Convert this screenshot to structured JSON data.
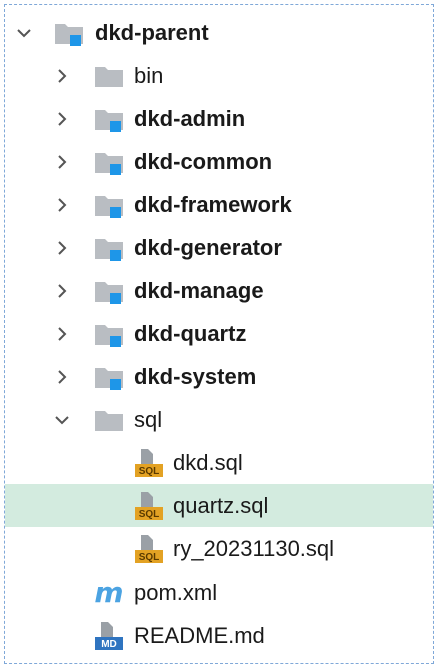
{
  "tree": {
    "root": {
      "label": "dkd-parent",
      "expanded": true,
      "icon": "module-folder-icon"
    },
    "items": [
      {
        "label": "bin",
        "type": "folder",
        "bold": false
      },
      {
        "label": "dkd-admin",
        "type": "module",
        "bold": true
      },
      {
        "label": "dkd-common",
        "type": "module",
        "bold": true
      },
      {
        "label": "dkd-framework",
        "type": "module",
        "bold": true
      },
      {
        "label": "dkd-generator",
        "type": "module",
        "bold": true
      },
      {
        "label": "dkd-manage",
        "type": "module",
        "bold": true
      },
      {
        "label": "dkd-quartz",
        "type": "module",
        "bold": true
      },
      {
        "label": "dkd-system",
        "type": "module",
        "bold": true
      },
      {
        "label": "sql",
        "type": "folder",
        "bold": false,
        "expanded": true,
        "children": [
          {
            "label": "dkd.sql",
            "type": "sql-file"
          },
          {
            "label": "quartz.sql",
            "type": "sql-file",
            "selected": true
          },
          {
            "label": "ry_20231130.sql",
            "type": "sql-file"
          }
        ]
      },
      {
        "label": "pom.xml",
        "type": "maven-file"
      },
      {
        "label": "README.md",
        "type": "markdown-file"
      }
    ]
  },
  "icons": {
    "sql_badge": "SQL",
    "md_badge": "MD",
    "maven_glyph": "m"
  },
  "colors": {
    "folder_gray": "#b9bdc2",
    "module_blue": "#1e96e8",
    "sql_badge": "#e3a224",
    "maven_blue": "#4ba3e2",
    "md_blue": "#2f74c0",
    "selection": "#d3ebdf"
  }
}
